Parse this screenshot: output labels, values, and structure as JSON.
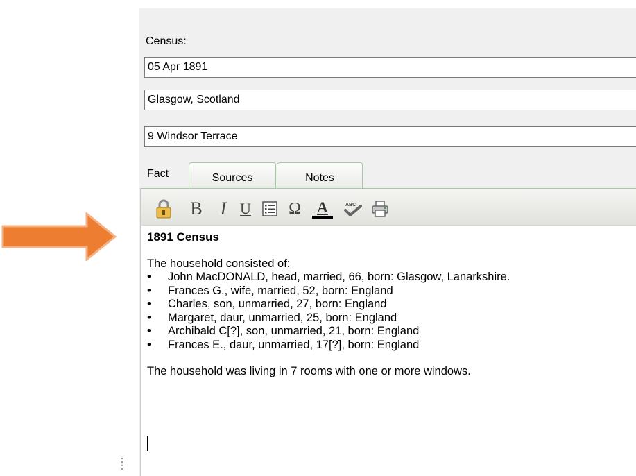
{
  "census": {
    "label": "Census:",
    "date_value": "05 Apr 1891",
    "place_value": "Glasgow, Scotland",
    "address_value": "9 Windsor Terrace"
  },
  "tabs": {
    "fact": "Fact",
    "sources": "Sources",
    "notes": "Notes"
  },
  "toolbar": {
    "bold": "B",
    "italic": "I",
    "underline": "U",
    "omega": "Ω",
    "text_color": "A"
  },
  "content": {
    "heading": "1891 Census",
    "intro": "The household consisted of:",
    "members": [
      "John MacDONALD, head, married, 66, born: Glasgow, Lanarkshire.",
      "Frances G., wife, married, 52, born: England",
      "Charles, son, unmarried, 27, born: England",
      "Margaret, daur, unmarried, 25, born: England",
      "Archibald C[?], son, unmarried, 21, born: England",
      "Frances E., daur, unmarried, 17[?], born: England"
    ],
    "footer": "The household was living in 7 rooms with one or more windows."
  },
  "colors": {
    "arrow": "#ed7d31",
    "arrow_border": "#f4b183",
    "tab_border": "#a4c7a4",
    "panel_bg": "#f0f0f0"
  },
  "icons": [
    "arrow-right-icon",
    "lock-icon",
    "bullet-list-icon",
    "text-color-icon",
    "spell-check-icon",
    "print-icon"
  ]
}
